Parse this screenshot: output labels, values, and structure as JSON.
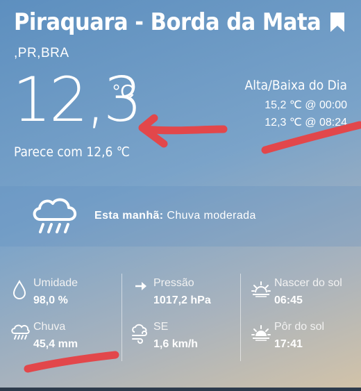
{
  "location": {
    "title": "Piraquara - Borda da Mata",
    "subtitle": ",PR,BRA"
  },
  "current": {
    "temperature": "12,3",
    "unit": "°C",
    "feels_like": "Parece com 12,6 ℃"
  },
  "day_range": {
    "title": "Alta/Baixa do Dia",
    "high": "15,2 ℃ @ 00:00",
    "low": "12,3 ℃ @ 08:24"
  },
  "forecast": {
    "period": "Esta manhã:",
    "condition": "Chuva moderada"
  },
  "details": {
    "humidity_label": "Umidade",
    "humidity_value": "98,0 %",
    "rain_label": "Chuva",
    "rain_value": "45,4 mm",
    "pressure_label": "Pressão",
    "pressure_value": "1017,2 hPa",
    "wind_label": "SE",
    "wind_value": "1,6 km/h",
    "sunrise_label": "Nascer do sol",
    "sunrise_value": "06:45",
    "sunset_label": "Pôr do sol",
    "sunset_value": "17:41"
  },
  "colors": {
    "annotation": "#e2474b",
    "bottom_bar": "#2d3b4c"
  },
  "icons": [
    "bookmark-icon",
    "rain-cloud-icon",
    "droplet-icon",
    "rain-icon",
    "arrow-right-icon",
    "wind-icon",
    "sunrise-icon",
    "sunset-icon"
  ]
}
